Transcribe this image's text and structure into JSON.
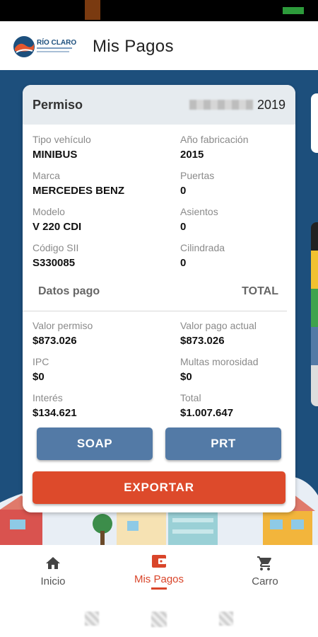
{
  "header": {
    "title": "Mis Pagos",
    "logo_text": "RÍO CLARO"
  },
  "card": {
    "title": "Permiso",
    "year": "2019",
    "vehicle_fields": [
      {
        "label": "Tipo vehículo",
        "value": "MINIBUS"
      },
      {
        "label": "Año fabricación",
        "value": "2015"
      },
      {
        "label": "Marca",
        "value": "MERCEDES BENZ"
      },
      {
        "label": "Puertas",
        "value": "0"
      },
      {
        "label": "Modelo",
        "value": "V 220 CDI"
      },
      {
        "label": "Asientos",
        "value": "0"
      },
      {
        "label": "Código SII",
        "value": "S330085"
      },
      {
        "label": "Cilindrada",
        "value": "0"
      }
    ],
    "payment_section_label": "Datos pago",
    "payment_section_right": "TOTAL",
    "payment_fields": [
      {
        "label": "Valor permiso",
        "value": "$873.026"
      },
      {
        "label": "Valor pago actual",
        "value": "$873.026"
      },
      {
        "label": "IPC",
        "value": "$0"
      },
      {
        "label": "Multas morosidad",
        "value": "$0"
      },
      {
        "label": "Interés",
        "value": "$134.621"
      },
      {
        "label": "Total",
        "value": "$1.007.647"
      }
    ],
    "soap_label": "SOAP",
    "prt_label": "PRT",
    "export_label": "EXPORTAR"
  },
  "bottom_nav": {
    "items": [
      {
        "label": "Inicio",
        "icon": "home-icon"
      },
      {
        "label": "Mis Pagos",
        "icon": "wallet-icon"
      },
      {
        "label": "Carro",
        "icon": "cart-icon"
      }
    ],
    "active_index": 1
  },
  "colors": {
    "primary_blue": "#1d4f7c",
    "button_blue": "#537aa6",
    "accent_orange": "#dd4a2b"
  }
}
